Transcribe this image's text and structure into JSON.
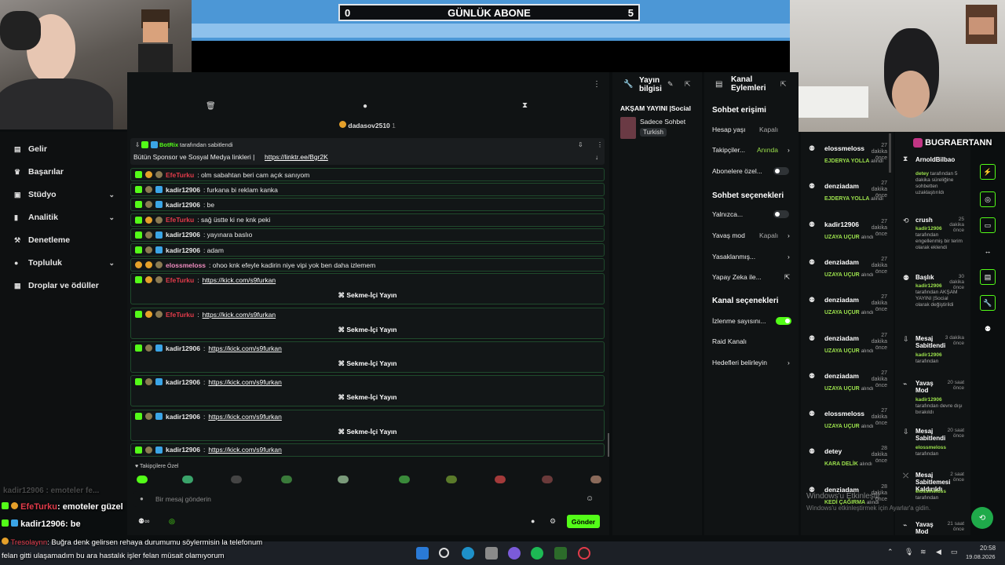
{
  "banner": {
    "left_count": "0",
    "label": "GÜNLÜK ABONE",
    "right_count": "5"
  },
  "sidebar": {
    "items": [
      {
        "icon": "inbox-icon",
        "label": "Gelir",
        "chev": ""
      },
      {
        "icon": "trophy-icon",
        "label": "Başarılar",
        "chev": ""
      },
      {
        "icon": "studio-icon",
        "label": "Stüdyo",
        "chev": "⌄"
      },
      {
        "icon": "chart-icon",
        "label": "Analitik",
        "chev": "⌄"
      },
      {
        "icon": "gavel-icon",
        "label": "Denetleme",
        "chev": ""
      },
      {
        "icon": "community-icon",
        "label": "Topluluk",
        "chev": "⌄"
      },
      {
        "icon": "gift-icon",
        "label": "Droplar ve ödüller",
        "chev": ""
      }
    ]
  },
  "chat": {
    "top_gifter": "dadasov2510",
    "top_gifter_count": "1",
    "pinned_by_name": "BotRix",
    "pinned_by_suffix": "tarafından sabitlendi",
    "pinned_text": "Bütün Sponsor ve Sosyal Medya linkleri |",
    "pinned_link": "https://linktr.ee/Bgr2K",
    "messages": [
      {
        "user": "EfeTurku",
        "color": "red",
        "text": ": olm sabahtan beri cam açık sanıyom",
        "badges": [
          "green",
          "gold",
          "tan"
        ],
        "embed": ""
      },
      {
        "user": "kadir12906",
        "color": "",
        "text": ": furkana bi reklam kanka",
        "badges": [
          "green",
          "tan",
          "blue"
        ],
        "embed": ""
      },
      {
        "user": "kadir12906",
        "color": "",
        "text": ": be",
        "badges": [
          "green",
          "tan",
          "blue"
        ],
        "embed": ""
      },
      {
        "user": "EfeTurku",
        "color": "red",
        "text": ": sağ üstte ki ne knk peki",
        "badges": [
          "green",
          "gold",
          "tan"
        ],
        "embed": ""
      },
      {
        "user": "kadir12906",
        "color": "",
        "text": ": yayınara baslıo",
        "badges": [
          "green",
          "tan",
          "blue"
        ],
        "embed": ""
      },
      {
        "user": "kadir12906",
        "color": "",
        "text": ": adam",
        "badges": [
          "green",
          "tan",
          "blue"
        ],
        "embed": ""
      },
      {
        "user": "elossmeloss",
        "color": "pink",
        "text": ": ohoo knk efeyle kadirin niye vipi yok ben daha izlemem",
        "badges": [
          "gold",
          "gold",
          "tan"
        ],
        "embed": ""
      },
      {
        "user": "EfeTurku",
        "color": "red",
        "link": "https://kick.com/s9furkan",
        "badges": [
          "green",
          "gold",
          "tan"
        ],
        "embed": "Sekme-İçi Yayın"
      },
      {
        "user": "EfeTurku",
        "color": "red",
        "link": "https://kick.com/s9furkan",
        "badges": [
          "green",
          "gold",
          "tan"
        ],
        "embed": "Sekme-İçi Yayın"
      },
      {
        "user": "kadir12906",
        "color": "",
        "link": "https://kick.com/s9furkan",
        "badges": [
          "green",
          "tan",
          "blue"
        ],
        "embed": "Sekme-İçi Yayın"
      },
      {
        "user": "kadir12906",
        "color": "",
        "link": "https://kick.com/s9furkan",
        "badges": [
          "green",
          "tan",
          "blue"
        ],
        "embed": "Sekme-İçi Yayın"
      },
      {
        "user": "kadir12906",
        "color": "",
        "link": "https://kick.com/s9furkan",
        "badges": [
          "green",
          "tan",
          "blue"
        ],
        "embed": "Sekme-İçi Yayın"
      },
      {
        "user": "kadir12906",
        "color": "",
        "link": "https://kick.com/s9furkan",
        "badges": [
          "green",
          "tan",
          "blue"
        ],
        "embed": ""
      }
    ],
    "emote_section": "Takipçilere Özel",
    "input_placeholder": "Bir mesaj gönderin",
    "send_label": "Gönder"
  },
  "stream_info": {
    "title": "Yayın bilgisi",
    "stream_title": "AKŞAM YAYINI |Social",
    "category": "Sadece Sohbet",
    "language": "Turkish"
  },
  "channel_actions": {
    "title": "Kanal Eylemleri",
    "chat_access": "Sohbet erişimi",
    "account_age_label": "Hesap yaşı",
    "account_age_value": "Kapalı",
    "followers_label": "Takipçiler...",
    "followers_value": "Anında",
    "subs_label": "Abonelere özel...",
    "chat_options": "Sohbet seçenekleri",
    "only_label": "Yalnızca...",
    "slow_label": "Yavaş mod",
    "slow_value": "Kapalı",
    "banned_label": "Yasaklanmış...",
    "ai_label": "Yapay Zeka ile...",
    "channel_options": "Kanal seçenekleri",
    "viewer_count_label": "İzlenme sayısını...",
    "raid_label": "Raid Kanalı",
    "goals_label": "Hedefleri belirleyin"
  },
  "activity": [
    {
      "name": "elossmeloss",
      "time": "27 dakika önce",
      "reward": "EJDERYA YOLLA",
      "suffix": "alındı"
    },
    {
      "name": "denziadam",
      "time": "27 dakika önce",
      "reward": "EJDERYA YOLLA",
      "suffix": "alındı"
    },
    {
      "name": "kadir12906",
      "time": "27 dakika önce",
      "reward": "UZAYA UÇUR",
      "suffix": "alındı"
    },
    {
      "name": "denziadam",
      "time": "27 dakika önce",
      "reward": "UZAYA UÇUR",
      "suffix": "alındı"
    },
    {
      "name": "denziadam",
      "time": "27 dakika önce",
      "reward": "UZAYA UÇUR",
      "suffix": "alındı"
    },
    {
      "name": "denziadam",
      "time": "27 dakika önce",
      "reward": "UZAYA UÇUR",
      "suffix": "alındı"
    },
    {
      "name": "denziadam",
      "time": "27 dakika önce",
      "reward": "UZAYA UÇUR",
      "suffix": "alındı"
    },
    {
      "name": "elossmeloss",
      "time": "27 dakika önce",
      "reward": "UZAYA UÇUR",
      "suffix": "alındı"
    },
    {
      "name": "detey",
      "time": "28 dakika önce",
      "reward": "KARA DELİK",
      "suffix": "alındı"
    },
    {
      "name": "denziadam",
      "time": "28 dakika önce",
      "reward": "KEDİ ÇAĞIRMA",
      "suffix": "alındı"
    }
  ],
  "modlog": {
    "top_name": "ArnoldBilbao",
    "handle": "BUGRAERTANN",
    "items": [
      {
        "title": "",
        "time": "",
        "body_user": "detey",
        "body": " tarafından 5 dakika süreliğine sohbetten uzaklaştırıldı"
      },
      {
        "title": "crush",
        "time": "25 dakika önce",
        "body_user": "kadir12906",
        "body": " tarafından engellenmiş bir terim olarak eklendi"
      },
      {
        "title": "Başlık",
        "time": "30 dakika önce",
        "body_user": "kadir12906",
        "body": " tarafından AKŞAM YAYINI |Social olarak değiştirildi"
      },
      {
        "title": "Mesaj Sabitlendi",
        "time": "3 dakika önce",
        "body_user": "kadir12906",
        "body": " tarafından"
      },
      {
        "title": "Yavaş Mod",
        "time": "20 saat önce",
        "body_user": "kadir12906",
        "body": " tarafından devre dışı bırakıldı"
      },
      {
        "title": "Mesaj Sabitlendi",
        "time": "20 saat önce",
        "body_user": "elossmeloss",
        "body": " tarafından"
      },
      {
        "title": "Mesaj Sabitlemesi Kaldırıldı",
        "time": "2 saat önce",
        "body_user": "elossmeloss",
        "body": " tarafından"
      },
      {
        "title": "Yavaş Mod",
        "time": "21 saat önce",
        "body_user": "",
        "body": ""
      }
    ]
  },
  "overlay": {
    "line1_user": "EfeTurku",
    "line1_text": ": emoteler güzel",
    "line2_user": "kadir12906",
    "line2_text": ": be",
    "line3_user": "Tresolaynn",
    "line3_text": ": Buğra denk gelirsen rehaya durumumu söylermisin la telefonum",
    "line4_text": "felan gitti ulaşamadım bu ara hastalık işler felan müsait olamıyorum",
    "faded": "kadir12906 : emoteler fe..."
  },
  "watermark": {
    "line1": "Windows'u Etkinleştir",
    "line2": "Windows'u etkinleştirmek için Ayarlar'a gidin."
  },
  "clock": {
    "time": "20:58",
    "date": "19.08.2026"
  }
}
